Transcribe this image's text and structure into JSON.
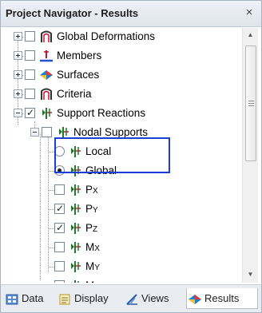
{
  "panel": {
    "title": "Project Navigator - Results",
    "close_glyph": "×"
  },
  "tree": {
    "global_deformations": {
      "label": "Global Deformations",
      "checked": false
    },
    "members": {
      "label": "Members",
      "checked": false
    },
    "surfaces": {
      "label": "Surfaces",
      "checked": false
    },
    "criteria": {
      "label": "Criteria",
      "checked": false
    },
    "support_reactions": {
      "label": "Support Reactions",
      "checked": true
    },
    "nodal_supports": {
      "label": "Nodal Supports",
      "checked": false
    },
    "local": {
      "label": "Local",
      "selected": false
    },
    "global": {
      "label": "Global",
      "selected": true
    },
    "px": {
      "letter": "P",
      "sub": "X",
      "checked": false
    },
    "py": {
      "letter": "P",
      "sub": "Y",
      "checked": true
    },
    "pz": {
      "letter": "P",
      "sub": "Z",
      "checked": true
    },
    "mx": {
      "letter": "M",
      "sub": "X",
      "checked": false
    },
    "my": {
      "letter": "M",
      "sub": "Y",
      "checked": false
    },
    "mz": {
      "letter": "M",
      "sub": "Z",
      "checked": false
    }
  },
  "tabs": [
    {
      "label": "Data",
      "icon": "data-icon",
      "active": false
    },
    {
      "label": "Display",
      "icon": "display-icon",
      "active": false
    },
    {
      "label": "Views",
      "icon": "views-icon",
      "active": false
    },
    {
      "label": "Results",
      "icon": "results-icon",
      "active": true
    }
  ],
  "colors": {
    "highlight_border": "#1b3fd4",
    "support_icon": "#1e7b2a",
    "accent_red": "#c8102e"
  }
}
